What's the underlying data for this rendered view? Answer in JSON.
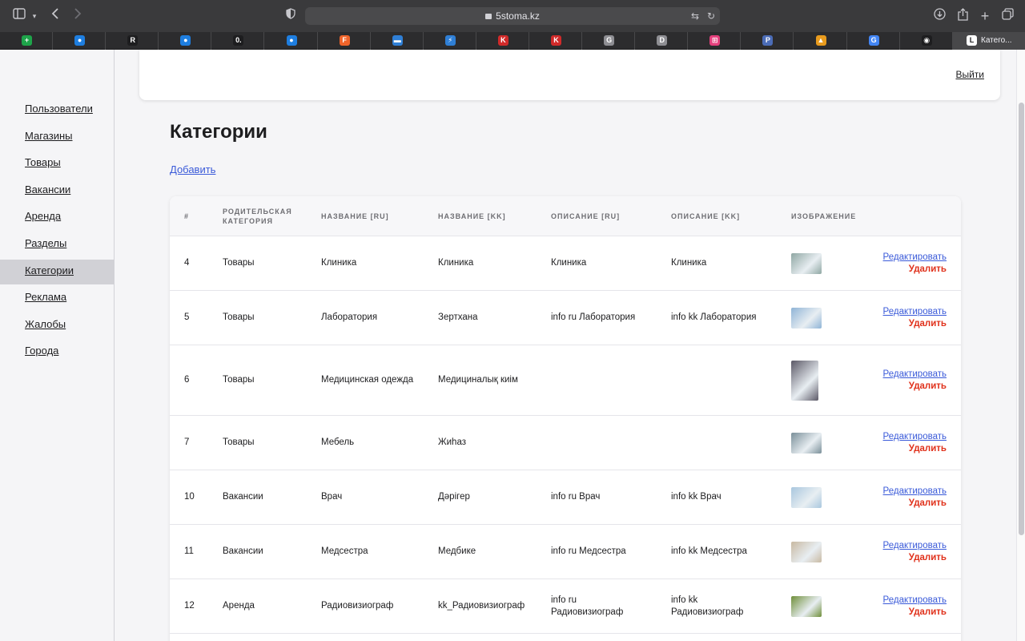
{
  "browser": {
    "url": "5stoma.kz",
    "active_tab_title": "Катего...",
    "tab_favicons": [
      {
        "letter": "+",
        "color": "#1ea44a"
      },
      {
        "letter": "●",
        "color": "#1e7ee0"
      },
      {
        "letter": "R",
        "color": "#1d1d1f"
      },
      {
        "letter": "●",
        "color": "#1e7ee0"
      },
      {
        "letter": "0.",
        "color": "#1d1d1f"
      },
      {
        "letter": "●",
        "color": "#1e7ee0"
      },
      {
        "letter": "F",
        "color": "#f0642a"
      },
      {
        "letter": "▬",
        "color": "#2f7fd6"
      },
      {
        "letter": "⚡",
        "color": "#2f7fd6"
      },
      {
        "letter": "K",
        "color": "#d12a2a"
      },
      {
        "letter": "K",
        "color": "#d12a2a"
      },
      {
        "letter": "G",
        "color": "#8e8e93"
      },
      {
        "letter": "D",
        "color": "#8e8e93"
      },
      {
        "letter": "⊞",
        "color": "#e5407d"
      },
      {
        "letter": "P",
        "color": "#4b6cb7"
      },
      {
        "letter": "▲",
        "color": "#e89b1e"
      },
      {
        "letter": "G",
        "color": "#4285f4"
      },
      {
        "letter": "◉",
        "color": "#1d1d1f"
      }
    ]
  },
  "sidebar": {
    "items": [
      {
        "label": "Пользователи",
        "active": false
      },
      {
        "label": "Магазины",
        "active": false
      },
      {
        "label": "Товары",
        "active": false
      },
      {
        "label": "Вакансии",
        "active": false
      },
      {
        "label": "Аренда",
        "active": false
      },
      {
        "label": "Разделы",
        "active": false
      },
      {
        "label": "Категории",
        "active": true
      },
      {
        "label": "Реклама",
        "active": false
      },
      {
        "label": "Жалобы",
        "active": false
      },
      {
        "label": "Города",
        "active": false
      }
    ]
  },
  "header": {
    "logout_label": "Выйти"
  },
  "page": {
    "title": "Категории",
    "add_label": "Добавить"
  },
  "table": {
    "columns": [
      "#",
      "РОДИТЕЛЬСКАЯ КАТЕГОРИЯ",
      "НАЗВАНИЕ [RU]",
      "НАЗВАНИЕ [KK]",
      "ОПИСАНИЕ [RU]",
      "ОПИСАНИЕ [KK]",
      "ИЗОБРАЖЕНИЕ"
    ],
    "edit_label": "Редактировать",
    "delete_label": "Удалить",
    "rows": [
      {
        "id": "4",
        "parent": "Товары",
        "name_ru": "Клиника",
        "name_kk": "Клиника",
        "desc_ru": "Клиника",
        "desc_kk": "Клиника",
        "image": "clinic-photo",
        "image_color": "#8fa7a3"
      },
      {
        "id": "5",
        "parent": "Товары",
        "name_ru": "Лаборатория",
        "name_kk": "Зертхана",
        "desc_ru": "info ru Лаборатория",
        "desc_kk": "info kk Лаборатория",
        "image": "lab-photo",
        "image_color": "#8fb4d6"
      },
      {
        "id": "6",
        "parent": "Товары",
        "name_ru": "Медицинская одежда",
        "name_kk": "Медициналық киім",
        "desc_ru": "",
        "desc_kk": "",
        "image": "scrubs-photo",
        "image_color": "#5b5866"
      },
      {
        "id": "7",
        "parent": "Товары",
        "name_ru": "Мебель",
        "name_kk": "Жиһаз",
        "desc_ru": "",
        "desc_kk": "",
        "image": "furniture-photo",
        "image_color": "#7a8f99"
      },
      {
        "id": "10",
        "parent": "Вакансии",
        "name_ru": "Врач",
        "name_kk": "Дәрігер",
        "desc_ru": "info ru Врач",
        "desc_kk": "info kk Врач",
        "image": "doctor-photo",
        "image_color": "#a9c7de"
      },
      {
        "id": "11",
        "parent": "Вакансии",
        "name_ru": "Медсестра",
        "name_kk": "Медбике",
        "desc_ru": "info ru Медсестра",
        "desc_kk": "info kk Медсестра",
        "image": "nurse-photo",
        "image_color": "#c8b9a2"
      },
      {
        "id": "12",
        "parent": "Аренда",
        "name_ru": "Радиовизиограф",
        "name_kk": "kk_Радиовизиограф",
        "desc_ru": "info ru Радиовизиограф",
        "desc_kk": "info kk Радиовизиограф",
        "image": "radiograph-photo",
        "image_color": "#6f8f3a"
      }
    ]
  }
}
